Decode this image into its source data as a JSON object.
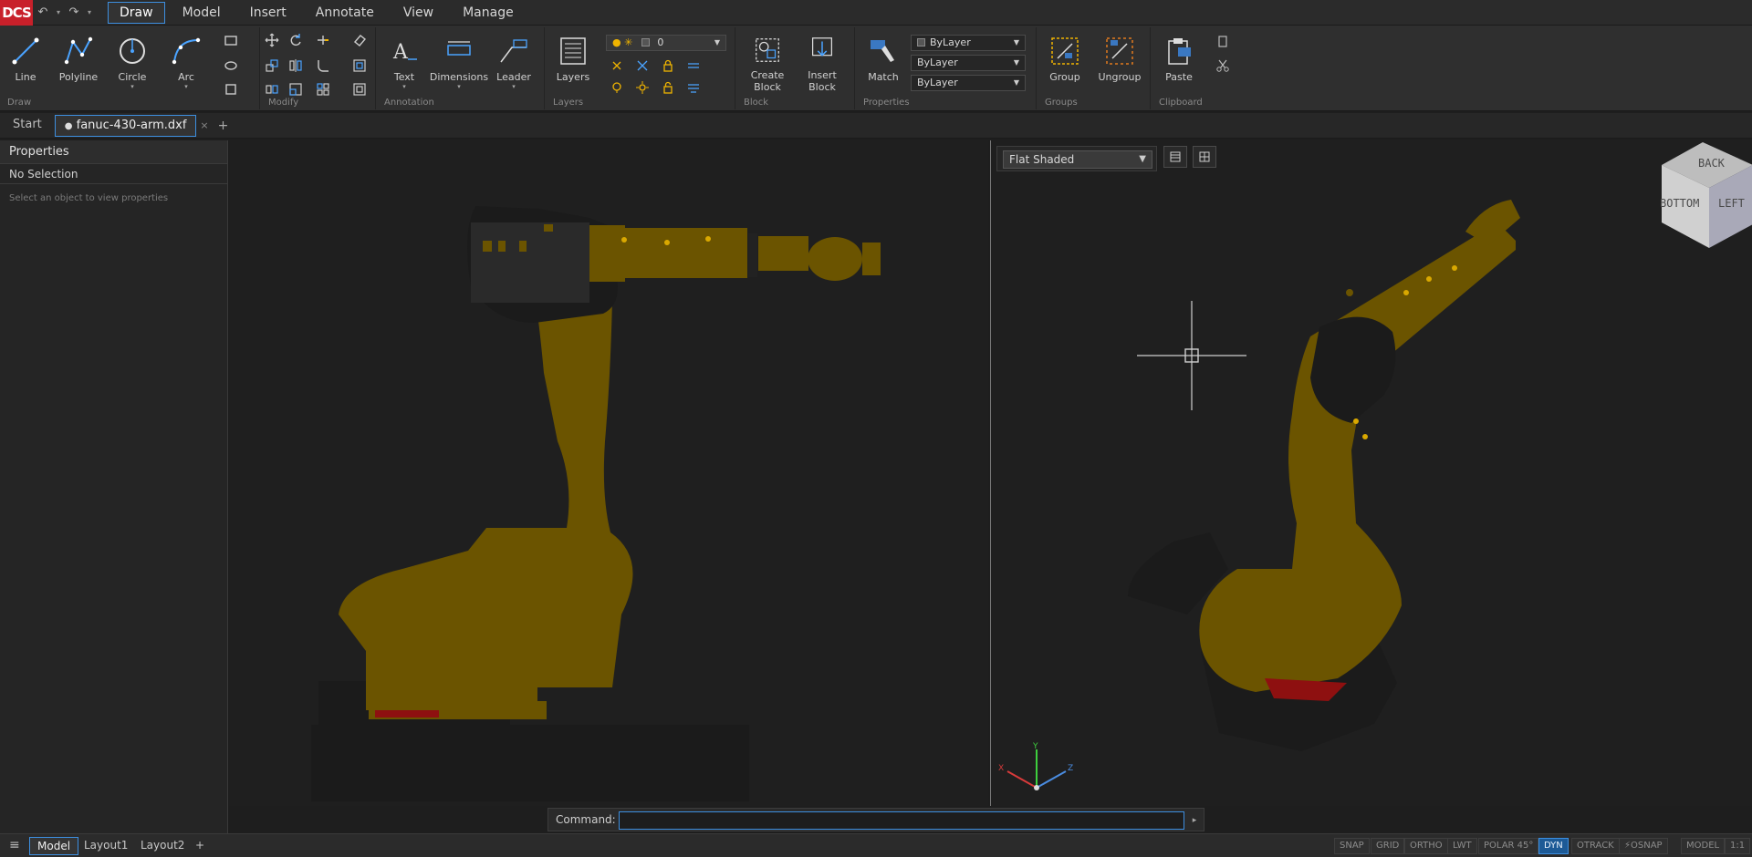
{
  "app": {
    "logo": "DCS"
  },
  "quick_access": {
    "undo": "↶",
    "redo": "↷",
    "more": "▾"
  },
  "menu": {
    "tabs": [
      "Draw",
      "Model",
      "Insert",
      "Annotate",
      "View",
      "Manage"
    ],
    "active": "Draw"
  },
  "ribbon": {
    "draw": {
      "title": "Draw",
      "line": "Line",
      "polyline": "Polyline",
      "circle": "Circle",
      "arc": "Arc"
    },
    "modify": {
      "title": "Modify"
    },
    "annotation": {
      "title": "Annotation",
      "text": "Text",
      "dimensions": "Dimensions",
      "leader": "Leader"
    },
    "layers": {
      "title": "Layers",
      "layers": "Layers",
      "current_layer": "0"
    },
    "block": {
      "title": "Block",
      "create": "Create\nBlock",
      "insert": "Insert\nBlock"
    },
    "properties": {
      "title": "Properties",
      "match": "Match",
      "color": "ByLayer",
      "linetype": "ByLayer",
      "lineweight": "ByLayer"
    },
    "groups": {
      "title": "Groups",
      "group": "Group",
      "ungroup": "Ungroup"
    },
    "clipboard": {
      "title": "Clipboard",
      "paste": "Paste"
    }
  },
  "doc_tabs": {
    "start": "Start",
    "file": "fanuc-430-arm.dxf",
    "close": "×",
    "add": "+"
  },
  "properties_panel": {
    "title": "Properties",
    "selection": "No Selection",
    "hint": "Select an object to view properties"
  },
  "viewport_right": {
    "visual_style": "Flat Shaded",
    "viewcube": {
      "top": "BACK",
      "front": "BOTTOM",
      "side": "LEFT"
    },
    "axes": {
      "x": "X",
      "y": "Y",
      "z": "Z"
    }
  },
  "command": {
    "label": "Command:",
    "value": "",
    "go": "▸"
  },
  "statusbar": {
    "menu_icon": "≡",
    "layouts": [
      "Model",
      "Layout1",
      "Layout2"
    ],
    "add": "+",
    "toggles": [
      "SNAP",
      "GRID",
      "ORTHO",
      "LWT",
      "POLAR 45°",
      "DYN",
      "OTRACK",
      "⚡OSNAP",
      "MODEL",
      "1:1"
    ],
    "active_toggle": "DYN"
  },
  "colors": {
    "accent": "#3d8fe0",
    "robot": "#6b5400",
    "logo": "#c8202a"
  }
}
